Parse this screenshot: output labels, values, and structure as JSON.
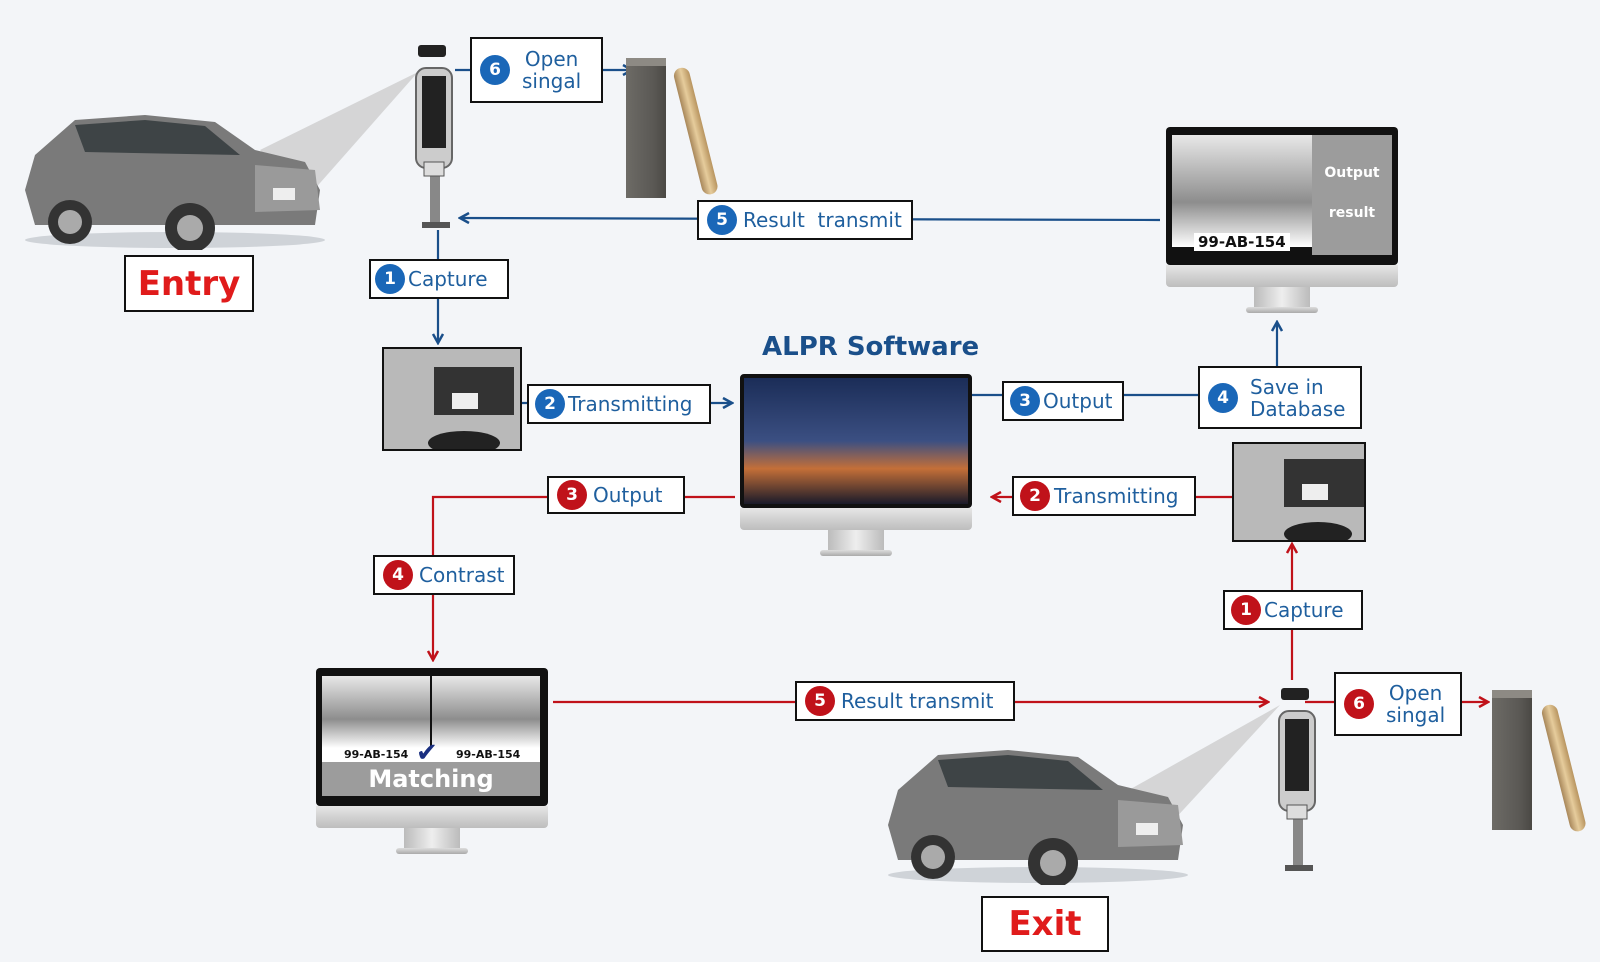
{
  "title": "ALPR Software",
  "places": {
    "entry": "Entry",
    "exit": "Exit"
  },
  "colors": {
    "entry_flow": "#1a4f8a",
    "exit_flow": "#c0121a",
    "label_text": "#1f5f9e",
    "place_text": "#e01b1b"
  },
  "entry_steps": [
    {
      "num": "1",
      "label": "Capture"
    },
    {
      "num": "2",
      "label": "Transmitting"
    },
    {
      "num": "3",
      "label": "Output"
    },
    {
      "num": "4",
      "label": "Save in\nDatabase"
    },
    {
      "num": "5",
      "label": "Result  transmit"
    },
    {
      "num": "6",
      "label": "Open\nsingal"
    }
  ],
  "exit_steps": [
    {
      "num": "1",
      "label": "Capture"
    },
    {
      "num": "2",
      "label": "Transmitting"
    },
    {
      "num": "3",
      "label": "Output"
    },
    {
      "num": "4",
      "label": "Contrast"
    },
    {
      "num": "5",
      "label": "Result transmit"
    },
    {
      "num": "6",
      "label": "Open\nsingal"
    }
  ],
  "output_monitor": {
    "plate": "99-AB-154",
    "side_line1": "Output",
    "side_line2": "result"
  },
  "matching_monitor": {
    "plate_left": "99-AB-154",
    "plate_right": "99-AB-154",
    "caption": "Matching"
  }
}
